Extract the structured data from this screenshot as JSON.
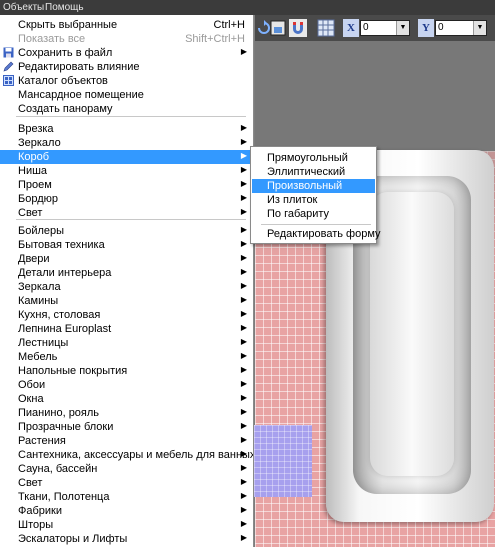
{
  "menubar": {
    "items": [
      "Объекты",
      "Помощь"
    ]
  },
  "toolbar": {
    "x_label": "X",
    "x_value": "0",
    "y_label": "Y",
    "y_value": "0"
  },
  "menu": {
    "group1": [
      {
        "label": "Скрыть выбранные",
        "shortcut": "Ctrl+H"
      },
      {
        "label": "Показать все",
        "shortcut": "Shift+Ctrl+H",
        "disabled": true
      },
      {
        "label": "Сохранить в файл",
        "icon": "save-icon",
        "submenu": true
      },
      {
        "label": "Редактировать влияние",
        "icon": "edit-icon"
      },
      {
        "label": "Каталог объектов",
        "icon": "catalog-icon"
      },
      {
        "label": "Мансардное помещение"
      },
      {
        "label": "Создать панораму"
      }
    ],
    "group2": [
      {
        "label": "Врезка"
      },
      {
        "label": "Зеркало"
      },
      {
        "label": "Короб",
        "highlighted": true
      },
      {
        "label": "Ниша"
      },
      {
        "label": "Проем"
      },
      {
        "label": "Бордюр"
      },
      {
        "label": "Свет"
      }
    ],
    "group3": [
      {
        "label": "Бойлеры"
      },
      {
        "label": "Бытовая техника"
      },
      {
        "label": "Двери"
      },
      {
        "label": "Детали интерьера"
      },
      {
        "label": "Зеркала"
      },
      {
        "label": "Камины"
      },
      {
        "label": "Кухня, столовая"
      },
      {
        "label": "Лепнина Europlast"
      },
      {
        "label": "Лестницы"
      },
      {
        "label": "Мебель"
      },
      {
        "label": "Напольные покрытия"
      },
      {
        "label": "Обои"
      },
      {
        "label": "Окна"
      },
      {
        "label": "Пианино, рояль"
      },
      {
        "label": "Прозрачные блоки"
      },
      {
        "label": "Растения"
      },
      {
        "label": "Сантехника, аксессуары и мебель для ванных комнат"
      },
      {
        "label": "Сауна, бассейн"
      },
      {
        "label": "Свет"
      },
      {
        "label": "Ткани, Полотенца"
      },
      {
        "label": "Фабрики"
      },
      {
        "label": "Шторы"
      },
      {
        "label": "Эскалаторы и Лифты"
      }
    ]
  },
  "submenu": {
    "items": [
      {
        "label": "Прямоугольный"
      },
      {
        "label": "Эллиптический"
      },
      {
        "label": "Произвольный",
        "highlighted": true
      },
      {
        "label": "Из плиток"
      },
      {
        "label": "По габариту"
      }
    ],
    "extra": [
      {
        "label": "Редактировать форму"
      }
    ]
  },
  "colors": {
    "highlight": "#3399ff",
    "menubar": "#3b3b3b",
    "wall_tile": "#e8a3a3"
  }
}
